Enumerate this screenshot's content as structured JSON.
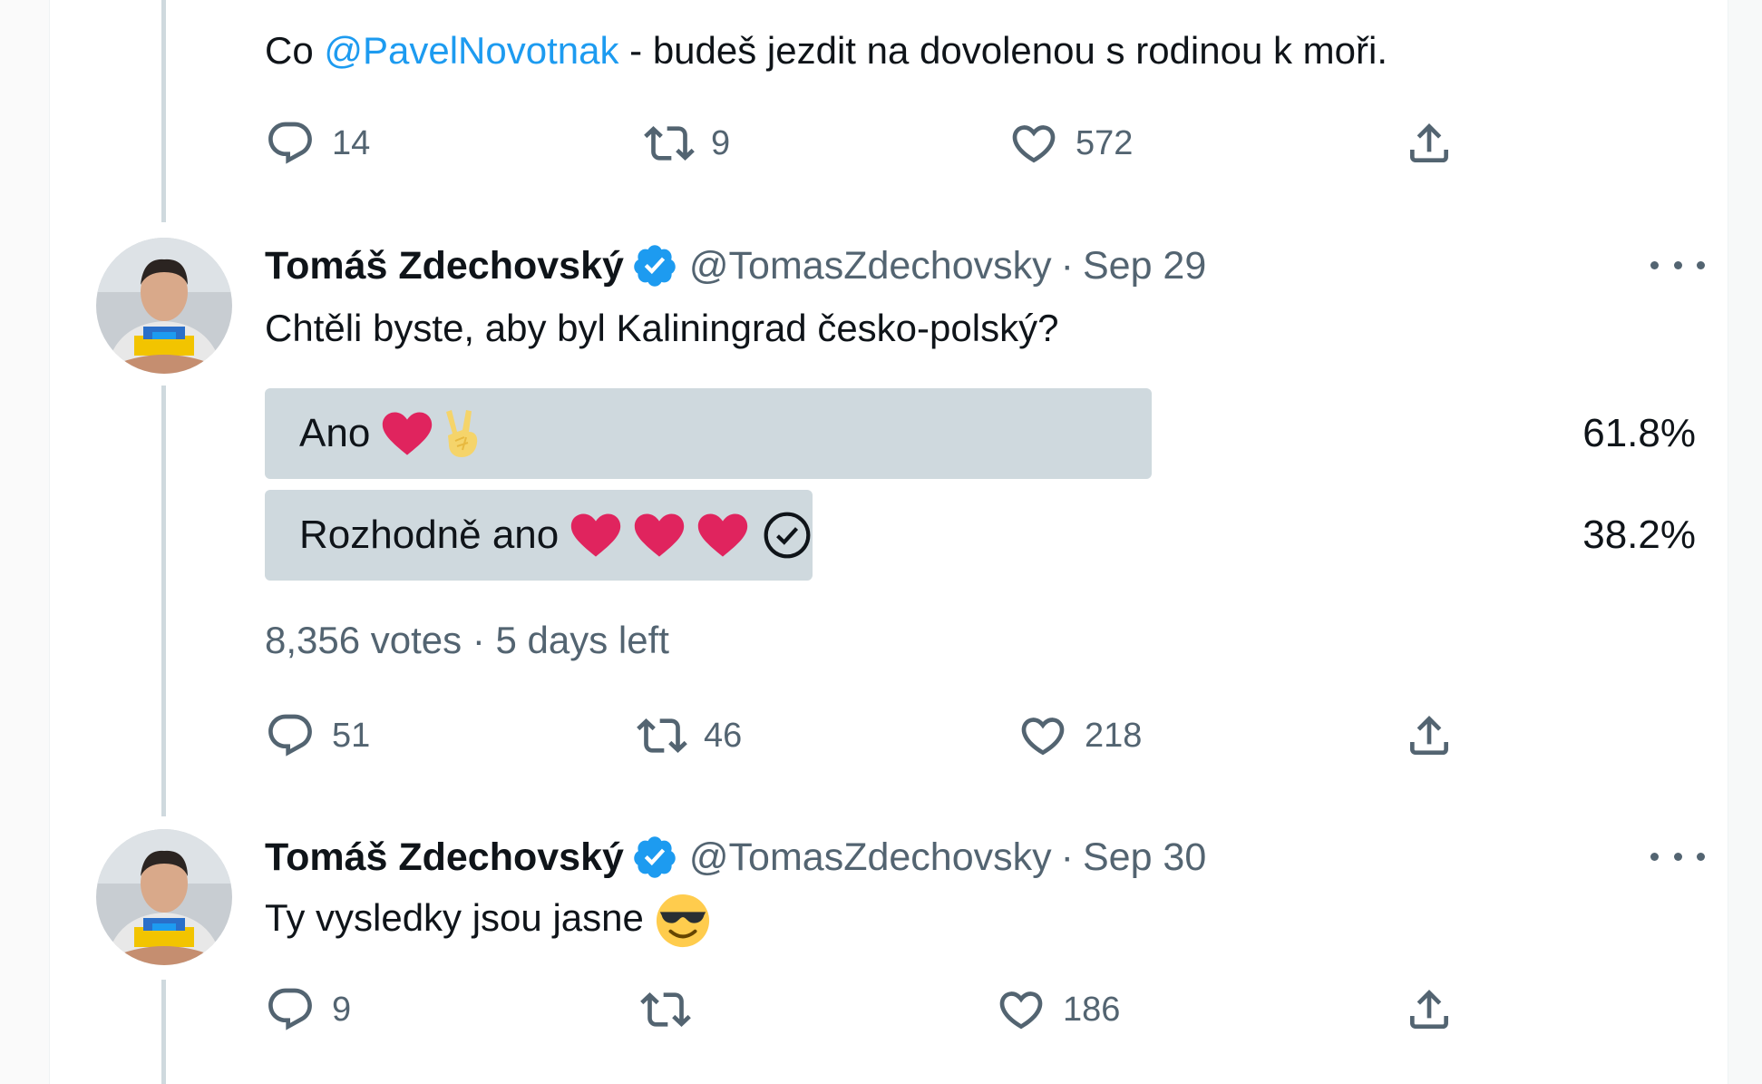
{
  "tweet_top": {
    "text_prefix": "Co ",
    "mention": "@PavelNovotnak",
    "text_suffix": " - budeš jezdit na dovolenou s rodinou k moři.",
    "replies": "14",
    "retweets": "9",
    "likes": "572"
  },
  "tweet_poll": {
    "display_name": "Tomáš Zdechovský",
    "handle": "@TomasZdechovsky",
    "separator": "·",
    "date": "Sep 29",
    "text": "Chtěli byste, aby byl Kaliningrad česko-polský?",
    "poll": {
      "options": [
        {
          "label": "Ano",
          "percent_text": "61.8%",
          "percent": 61.8,
          "emojis": [
            "red-heart",
            "victory-hand-ukraine"
          ],
          "chosen": false
        },
        {
          "label": "Rozhodně ano",
          "percent_text": "38.2%",
          "percent": 38.2,
          "emojis": [
            "red-heart",
            "red-heart",
            "red-heart"
          ],
          "chosen": true
        }
      ],
      "votes": "8,356 votes",
      "separator": "·",
      "time_left": "5 days left"
    },
    "replies": "51",
    "retweets": "46",
    "likes": "218"
  },
  "tweet_reply": {
    "display_name": "Tomáš Zdechovský",
    "handle": "@TomasZdechovsky",
    "separator": "·",
    "date": "Sep 30",
    "text": "Ty vysledky jsou jasne",
    "emoji": "smiling-face-with-sunglasses",
    "replies": "9",
    "retweets": "",
    "likes": "186"
  },
  "colors": {
    "link": "#1d9bf0",
    "text": "#0f1419",
    "secondary": "#536471",
    "poll_bar": "#cfd9de",
    "thread_line": "#cfd9de",
    "verified": "#1d9bf0",
    "heart": "#e0245e"
  },
  "icons": [
    "reply-icon",
    "retweet-icon",
    "like-icon",
    "share-icon",
    "verified-badge-icon",
    "more-icon",
    "check-circle-icon"
  ]
}
